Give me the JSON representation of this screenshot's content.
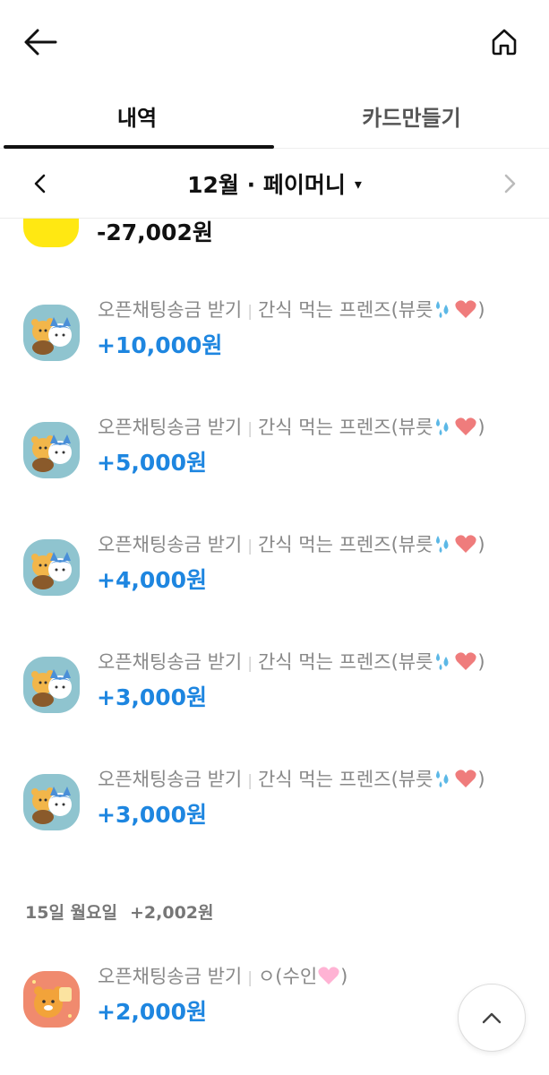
{
  "tabs": [
    {
      "label": "내역",
      "active": true
    },
    {
      "label": "카드만들기",
      "active": false
    }
  ],
  "month_selector": {
    "label": "12월 · 페이머니",
    "caret": "▾"
  },
  "partial_item": {
    "amount": "-27,002원"
  },
  "items": [
    {
      "title": "오픈채팅송금 받기",
      "counterparty": "간식 먹는 프렌즈(뷰릇",
      "amount": "+10,000원"
    },
    {
      "title": "오픈채팅송금 받기",
      "counterparty": "간식 먹는 프렌즈(뷰릇",
      "amount": "+5,000원"
    },
    {
      "title": "오픈채팅송금 받기",
      "counterparty": "간식 먹는 프렌즈(뷰릇",
      "amount": "+4,000원"
    },
    {
      "title": "오픈채팅송금 받기",
      "counterparty": "간식 먹는 프렌즈(뷰릇",
      "amount": "+3,000원"
    },
    {
      "title": "오픈채팅송금 받기",
      "counterparty": "간식 먹는 프렌즈(뷰릇",
      "amount": "+3,000원"
    }
  ],
  "date_header": {
    "date": "15일 월요일",
    "total": "+2,002원"
  },
  "last_item": {
    "title": "오픈채팅송금 받기",
    "counterparty": "ㅇ(수인",
    "amount": "+2,000원"
  },
  "colors": {
    "accent": "#1e86e0",
    "kakao_yellow": "#ffe812",
    "avatar_bg": "#8fc4cf",
    "avatar_bg_orange": "#f08a6e"
  },
  "icons": [
    "back-arrow-icon",
    "home-icon",
    "chevron-left-icon",
    "chevron-right-icon",
    "caret-down-icon",
    "chevron-up-icon",
    "sweat-drops-emoji",
    "heart-emoji",
    "pink-heart-emoji"
  ]
}
